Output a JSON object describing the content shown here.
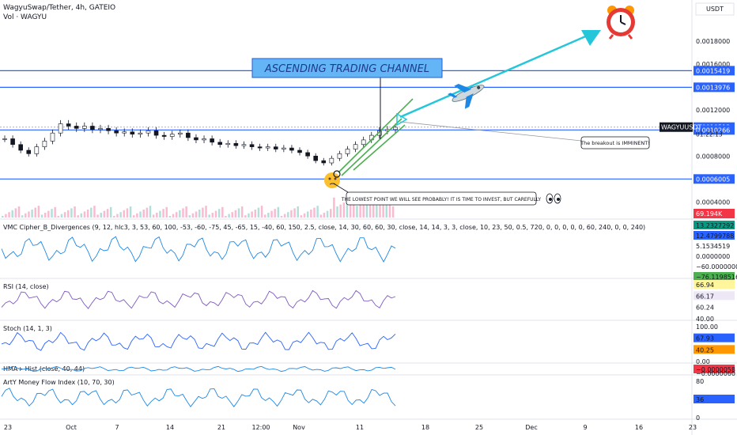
{
  "header": {
    "symbol": "WagyuSwap/Tether, 4h, GATEIO",
    "volume": "Vol · WAGYU"
  },
  "currency": "USDT",
  "chart_data": {
    "type": "line",
    "title": "ASCENDING TRADING CHANNEL",
    "symbol_tag": "WAGYUUSDT",
    "countdown": "01:22:13",
    "price_axis": {
      "ticks": [
        "0.0018000",
        "0.0016000",
        "0.0012000",
        "0.0008000",
        "0.0004000"
      ],
      "tagged": [
        {
          "label": "0.0015419",
          "value": 0.0015419
        },
        {
          "label": "0.0013976",
          "value": 0.0013976
        },
        {
          "label": "0.0010513",
          "value": 0.0010513
        },
        {
          "label": "0.0010266",
          "value": 0.0010266
        },
        {
          "label": "0.0006005",
          "value": 0.0006005
        }
      ],
      "ylim": [
        0.0003,
        0.00195
      ]
    },
    "levels": [
      0.0015419,
      0.0013976,
      0.0010266,
      0.0006005
    ],
    "volume_tag": "69.194K",
    "time_axis": [
      "23",
      "Oct",
      "7",
      "14",
      "21",
      "12:00",
      "Nov",
      "11",
      "18",
      "25",
      "Dec",
      "9",
      "16",
      "23"
    ],
    "price_series": [
      0.00095,
      0.0009,
      0.00085,
      0.00082,
      0.00088,
      0.00093,
      0.001,
      0.00108,
      0.00106,
      0.00104,
      0.00106,
      0.00103,
      0.00104,
      0.00102,
      0.001,
      0.00101,
      0.00099,
      0.001,
      0.00102,
      0.00098,
      0.00097,
      0.00099,
      0.001,
      0.00096,
      0.00094,
      0.00095,
      0.00092,
      0.0009,
      0.00091,
      0.00089,
      0.0009,
      0.00088,
      0.00087,
      0.00088,
      0.00086,
      0.00087,
      0.00085,
      0.00083,
      0.0008,
      0.00076,
      0.00074,
      0.00078,
      0.00082,
      0.00086,
      0.0009,
      0.00094,
      0.00098,
      0.00102,
      0.00103,
      0.00105
    ],
    "annotations": [
      {
        "text": "The breakout is IMMINENT!"
      },
      {
        "text": "THE LOWEST POINT WE WILL SEE PROBABLY! IT IS TIME TO INVEST, BUT CAREFULLY"
      }
    ],
    "indicators": [
      {
        "name": "VMC Cipher_B_Divergences (9, 12, hlc3, 3, 53, 60, 100, -53, -60, -75, 45, -65, 15, -40, 60, 150, 2.5, close, 14, 30, 60, 60, 30, close, 14, 14, 3, 3, close, 10, 23, 50, 0.5, 720, 0, 0, 0, 0, 0, 60, 240, 0, 0, 240)",
        "axis": [
          "13.2327292",
          "12.4799788",
          "5.1534519",
          "0.0000000",
          "−60.0000000",
          "−76.1198516"
        ],
        "tag_colors": [
          "#089981",
          "#2962ff",
          "#ffffff",
          "#ffffff",
          "#ffffff",
          "#4caf50"
        ]
      },
      {
        "name": "RSI (14, close)",
        "axis": [
          "66.94",
          "66.17",
          "60.24",
          "40.00"
        ],
        "tag_colors": [
          "#fff59d",
          "#ede7f6",
          "#ffffff",
          "#ffffff"
        ]
      },
      {
        "name": "Stoch (14, 1, 3)",
        "axis": [
          "100.00",
          "67.93",
          "40.25",
          "0.00"
        ],
        "tag_colors": [
          "#ffffff",
          "#2962ff",
          "#ff9800",
          "#ffffff"
        ]
      },
      {
        "name": "HMA+ Hist (close, 40, 44)",
        "axis": [
          "−0.0000058",
          "−0.0000060"
        ],
        "tag_colors": [
          "#f23645",
          "#ffffff"
        ]
      },
      {
        "name": "ArtY Money Flow Index (10, 70, 30)",
        "axis": [
          "80",
          "36",
          "0"
        ],
        "tag_colors": [
          "#ffffff",
          "#2962ff",
          "#ffffff"
        ]
      }
    ]
  },
  "colors": {
    "level_line": "#2962ff",
    "candle": "#131722",
    "channel": "#4caf50",
    "arrow": "#26c6da",
    "title_bg": "#64b5f6"
  },
  "icons": [
    "alarm-clock-icon",
    "airplane-icon",
    "thinking-face-icon",
    "eyes-icon"
  ]
}
